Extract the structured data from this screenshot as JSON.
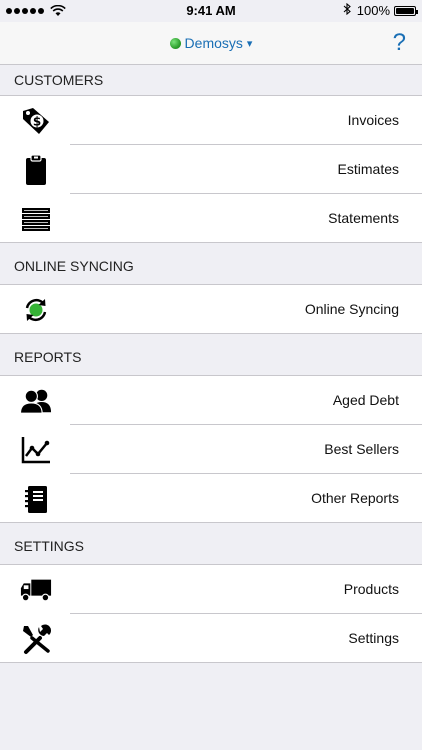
{
  "status_bar": {
    "time": "9:41 AM",
    "battery": "100%",
    "battery_level": 1.0,
    "signal_bars": 5
  },
  "nav": {
    "title": "Demosys",
    "caret": "▾",
    "help": "?",
    "accent_color": "#1a6fb5"
  },
  "sections": {
    "customers": {
      "title": "CUSTOMERS",
      "items": [
        {
          "label": "Invoices",
          "icon": "price-tag-dollar-icon"
        },
        {
          "label": "Estimates",
          "icon": "clipboard-icon"
        },
        {
          "label": "Statements",
          "icon": "stack-icon"
        }
      ]
    },
    "online_syncing": {
      "title": "ONLINE SYNCING",
      "items": [
        {
          "label": "Online Syncing",
          "icon": "sync-icon"
        }
      ]
    },
    "reports": {
      "title": "REPORTS",
      "items": [
        {
          "label": "Aged Debt",
          "icon": "users-icon"
        },
        {
          "label": "Best Sellers",
          "icon": "line-chart-icon"
        },
        {
          "label": "Other Reports",
          "icon": "notebook-icon"
        }
      ]
    },
    "settings": {
      "title": "SETTINGS",
      "items": [
        {
          "label": "Products",
          "icon": "truck-icon"
        },
        {
          "label": "Settings",
          "icon": "tools-icon"
        }
      ]
    }
  }
}
